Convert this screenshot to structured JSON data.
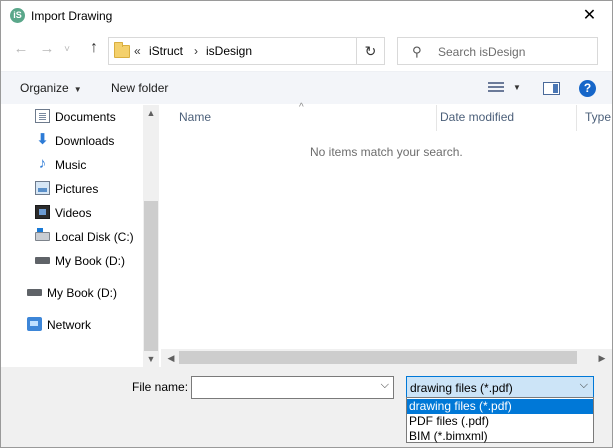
{
  "window": {
    "title": "Import Drawing",
    "close_glyph": "✕",
    "app_icon_glyph": "iS"
  },
  "nav": {
    "back_glyph": "←",
    "forward_glyph": "→",
    "recent_glyph": "˅",
    "up_glyph": "↑",
    "refresh_glyph": "↻",
    "breadcrumb": {
      "overflow": "«",
      "sep": "›",
      "items": [
        "iStruct",
        "isDesign"
      ]
    },
    "search_placeholder": "Search isDesign",
    "search_glyph": "⚲"
  },
  "toolbar": {
    "organize_label": "Organize",
    "caret_glyph": "▼",
    "new_folder_label": "New folder",
    "help_glyph": "?"
  },
  "sidebar": {
    "items": [
      {
        "label": "Documents",
        "icon": "documents-icon"
      },
      {
        "label": "Downloads",
        "icon": "downloads-icon"
      },
      {
        "label": "Music",
        "icon": "music-icon"
      },
      {
        "label": "Pictures",
        "icon": "pictures-icon"
      },
      {
        "label": "Videos",
        "icon": "videos-icon"
      },
      {
        "label": "Local Disk (C:)",
        "icon": "local-disk-icon"
      },
      {
        "label": "My Book (D:)",
        "icon": "usb-drive-icon"
      },
      {
        "label": "My Book (D:)",
        "icon": "usb-drive-icon"
      },
      {
        "label": "Network",
        "icon": "network-icon"
      }
    ],
    "glyphs": {
      "down_arrow": "⬇",
      "music_note": "♪"
    }
  },
  "columns": {
    "name": "Name",
    "date": "Date modified",
    "type": "Type",
    "sort_glyph": "^"
  },
  "content": {
    "empty_message": "No items match your search."
  },
  "scroll_glyphs": {
    "up": "▲",
    "down": "▼",
    "left": "◀",
    "right": "▶"
  },
  "footer": {
    "file_name_label": "File name:",
    "file_name_value": "",
    "combo_caret": "⌵",
    "file_type_selected": "drawing files (*.pdf)",
    "file_type_options": [
      "drawing files (*.pdf)",
      "PDF files (.pdf)",
      "BIM (*.bimxml)"
    ]
  },
  "colors": {
    "accent": "#0078d7",
    "selected_bg": "#cce4f7",
    "help_blue": "#1666c9"
  }
}
